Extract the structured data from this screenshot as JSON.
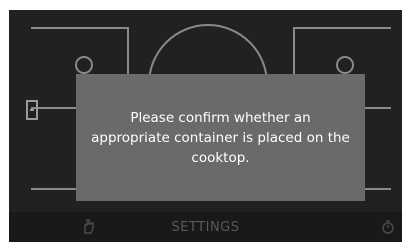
{
  "dialog": {
    "message": "Please confirm whether an appropriate container is placed on the cooktop."
  },
  "bottom_bar": {
    "settings_label": "SETTINGS",
    "left_icon": "hand-icon",
    "right_icon": "timer-icon"
  },
  "colors": {
    "background": "#212123",
    "dialog": "#6a6a6b",
    "lines": "#8a8a8a",
    "text": "#ffffff"
  }
}
